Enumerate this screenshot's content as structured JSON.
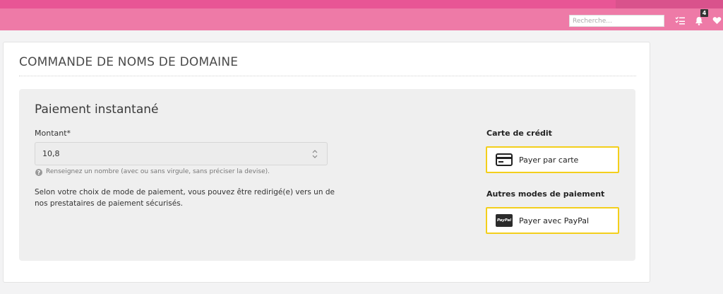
{
  "header": {
    "search_placeholder": "Recherche...",
    "notification_count": "4"
  },
  "page": {
    "title": "COMMANDE DE NOMS DE DOMAINE"
  },
  "payment": {
    "title": "Paiement instantané",
    "amount_label": "Montant*",
    "amount_value": "10,8",
    "hint": "Renseignez un nombre (avec ou sans virgule, sans préciser la devise).",
    "description": "Selon votre choix de mode de paiement, vous pouvez être redirigé(e) vers un de nos prestataires de paiement sécurisés.",
    "credit_card_heading": "Carte de crédit",
    "card_button_label": "Payer par carte",
    "other_heading": "Autres modes de paiement",
    "paypal_button_label": "Payer avec PayPal",
    "paypal_logo_text": "PayPal"
  },
  "colors": {
    "topbar": "#ee7aa7",
    "topbar_stripe": "#e85595",
    "button_border": "#f3cf1c"
  }
}
